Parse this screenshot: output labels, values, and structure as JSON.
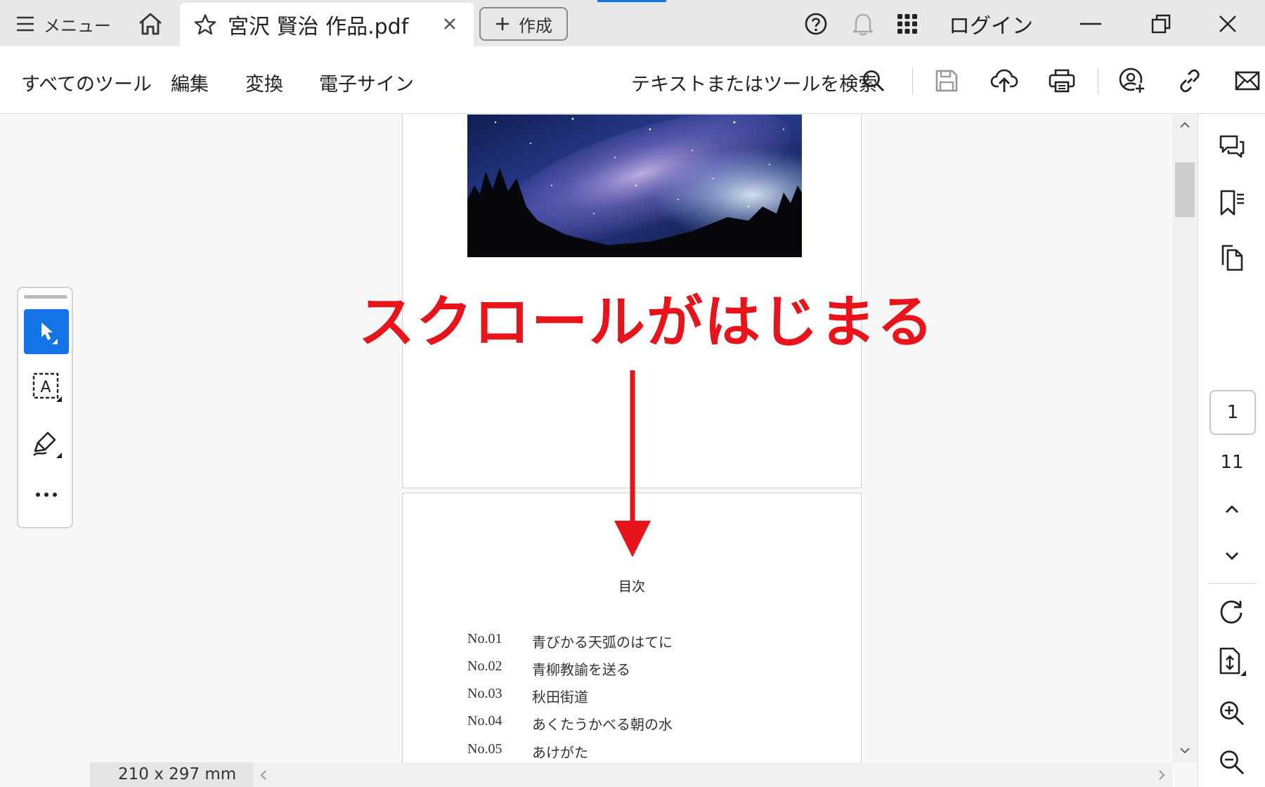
{
  "tabbar": {
    "menu_label": "メニュー",
    "tab_title": "宮沢 賢治 作品.pdf",
    "create_label": "作成",
    "login_label": "ログイン"
  },
  "toolbar": {
    "items": [
      "すべてのツール",
      "編集",
      "変換",
      "電子サイン"
    ],
    "search_placeholder": "テキストまたはツールを検索"
  },
  "document": {
    "annotation": "スクロールがはじまる",
    "toc_heading": "目次",
    "toc": [
      {
        "no": "No.01",
        "title": "青びかる天弧のはてに"
      },
      {
        "no": "No.02",
        "title": "青柳教諭を送る"
      },
      {
        "no": "No.03",
        "title": "秋田街道"
      },
      {
        "no": "No.04",
        "title": "あくたうかべる朝の水"
      },
      {
        "no": "No.05",
        "title": "あけがた"
      }
    ]
  },
  "navigation": {
    "current_page": "1",
    "total_pages": "11"
  },
  "status": {
    "page_size": "210 x 297 mm"
  },
  "colors": {
    "accent": "#1473e6",
    "annotation": "#e8141b"
  },
  "icons": [
    "menu-icon",
    "home-icon",
    "star-icon",
    "close-icon",
    "plus-icon",
    "help-icon",
    "bell-icon",
    "apps-icon",
    "search-icon",
    "save-icon",
    "upload-icon",
    "print-icon",
    "share-user-icon",
    "link-icon",
    "mail-icon",
    "select-cursor-icon",
    "text-select-icon",
    "draw-pen-icon",
    "more-icon",
    "comment-icon",
    "bookmark-icon",
    "pages-icon",
    "rotate-icon",
    "extract-icon",
    "zoom-in-icon",
    "zoom-out-icon"
  ]
}
